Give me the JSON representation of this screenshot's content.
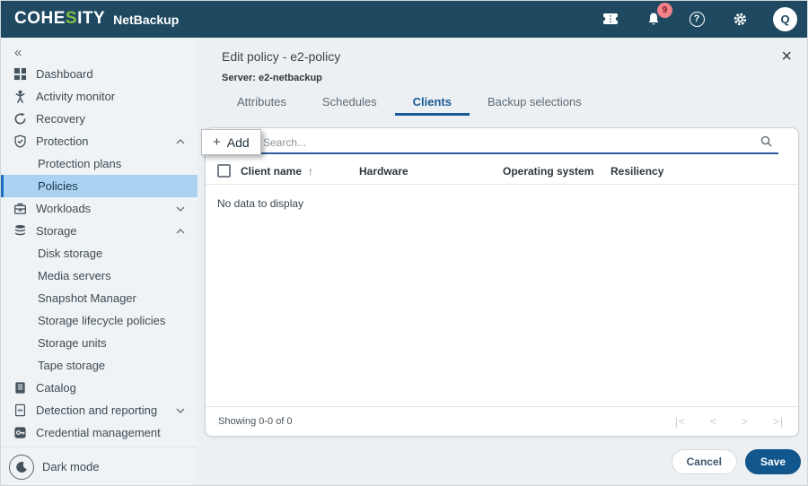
{
  "topbar": {
    "brand": {
      "pre": "COHE",
      "s": "S",
      "post": "ITY",
      "product": "NetBackup"
    },
    "notifications": {
      "count": "9"
    },
    "help_glyph": "?",
    "avatar_initial": "Q"
  },
  "sidebar": {
    "collapse_glyph": "«",
    "items": [
      {
        "label": "Dashboard"
      },
      {
        "label": "Activity monitor"
      },
      {
        "label": "Recovery"
      },
      {
        "label": "Protection",
        "state": "expanded"
      },
      {
        "label": "Protection plans",
        "child": true
      },
      {
        "label": "Policies",
        "child": true,
        "selected": true
      },
      {
        "label": "Workloads",
        "state": "collapsed"
      },
      {
        "label": "Storage",
        "state": "expanded"
      },
      {
        "label": "Disk storage",
        "child": true
      },
      {
        "label": "Media servers",
        "child": true
      },
      {
        "label": "Snapshot Manager",
        "child": true
      },
      {
        "label": "Storage lifecycle policies",
        "child": true
      },
      {
        "label": "Storage units",
        "child": true
      },
      {
        "label": "Tape storage",
        "child": true
      },
      {
        "label": "Catalog"
      },
      {
        "label": "Detection and reporting",
        "state": "collapsed"
      },
      {
        "label": "Credential management"
      }
    ],
    "dark_mode_label": "Dark mode"
  },
  "panel": {
    "title": "Edit policy - e2-policy",
    "close_glyph": "×",
    "server": "Server: e2-netbackup",
    "tabs": [
      {
        "label": "Attributes"
      },
      {
        "label": "Schedules"
      },
      {
        "label": "Clients",
        "active": true
      },
      {
        "label": "Backup selections"
      }
    ],
    "toolbar": {
      "add_plus": "+",
      "add_label": "Add",
      "search_placeholder": "Search..."
    },
    "table": {
      "columns": [
        {
          "label": "Client name",
          "sort": "asc"
        },
        {
          "label": "Hardware"
        },
        {
          "label": "Operating system"
        },
        {
          "label": "Resiliency"
        }
      ],
      "sort_glyph": "↑",
      "empty_message": "No data to display",
      "footer": {
        "showing": "Showing 0-0 of 0",
        "pagination": [
          "|<",
          "<",
          ">",
          ">|"
        ]
      }
    },
    "actions": {
      "cancel": "Cancel",
      "save": "Save"
    }
  },
  "colors": {
    "topbar_bg": "#1e4961",
    "brand_green": "#84bd3f",
    "badge_bg": "#f2838a",
    "selected_item_bg": "#abd3f1",
    "selected_item_border": "#1a6fbf",
    "tab_active": "#185a96",
    "search_underline": "#2b5e9e",
    "save_bg": "#11568c"
  }
}
